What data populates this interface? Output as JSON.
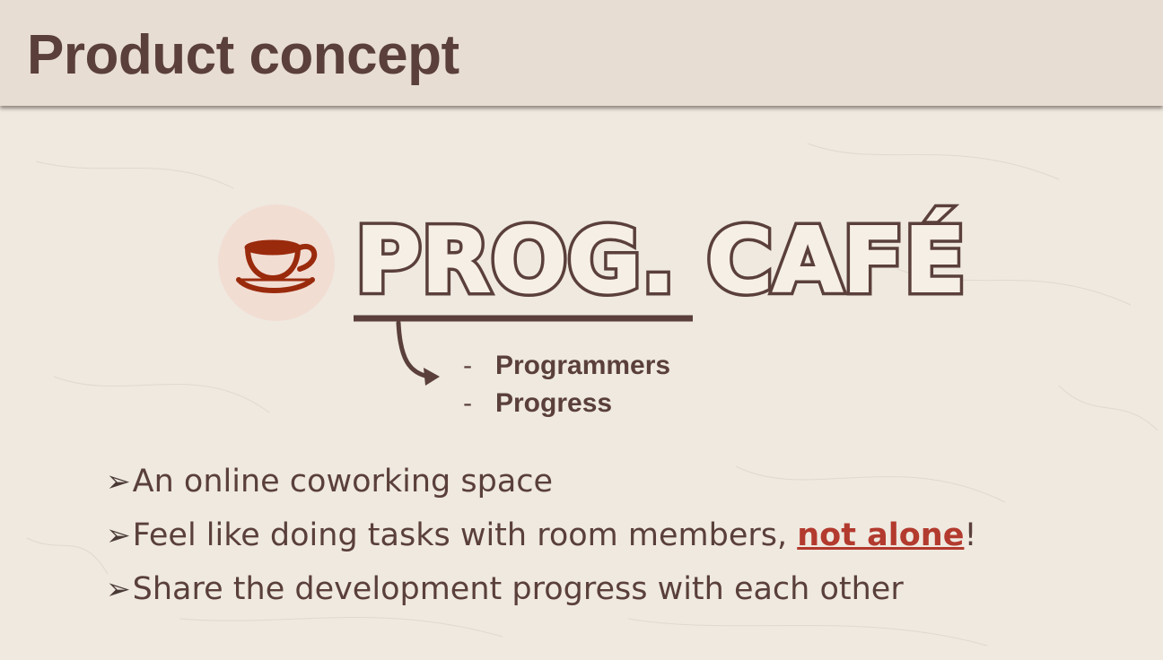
{
  "header": {
    "title": "Product concept"
  },
  "logo": {
    "icon": "coffee-cup-icon",
    "wordmark": "PROG. CAFÉ",
    "colors": {
      "brand": "#5a3f3a",
      "cup": "#9a2a0c",
      "circle": "#f2ddd3"
    }
  },
  "prog_meanings": [
    {
      "dash": "-",
      "text": "Programmers"
    },
    {
      "dash": "-",
      "text": "Progress"
    }
  ],
  "bullets": [
    {
      "marker": "➢",
      "text": "An online coworking space"
    },
    {
      "marker": "➢",
      "text": "Feel like doing tasks with room members, ",
      "emphasis": "not alone",
      "suffix": "!"
    },
    {
      "marker": "➢",
      "text": "Share the development progress with each other"
    }
  ],
  "colors": {
    "text": "#5a3f3a",
    "emphasis": "#b33a2e",
    "header_bg": "#e8ddd2",
    "page_bg": "#efe9e0"
  }
}
